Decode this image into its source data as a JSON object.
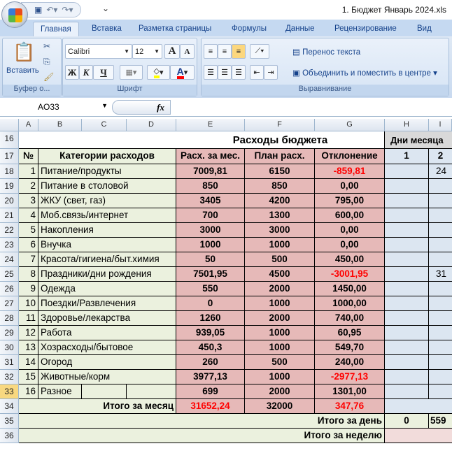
{
  "window": {
    "title": "1.  Бюджет Январь 2024.xls"
  },
  "tabs": [
    "Главная",
    "Вставка",
    "Разметка страницы",
    "Формулы",
    "Данные",
    "Рецензирование",
    "Вид"
  ],
  "ribbon": {
    "clipboard": {
      "label": "Буфер о...",
      "paste": "Вставить"
    },
    "font": {
      "label": "Шрифт",
      "name": "Calibri",
      "size": "12",
      "bold": "Ж",
      "italic": "К",
      "underline": "Ч",
      "grow": "A",
      "shrink": "A",
      "color_letter": "A",
      "fill_color": "#ffff00",
      "font_color": "#ff0000"
    },
    "alignment": {
      "label": "Выравнивание",
      "wrap": "Перенос текста",
      "merge": "Объединить и поместить в центре"
    }
  },
  "formula_bar": {
    "name_box": "AO33",
    "fx": "fx",
    "formula": ""
  },
  "columns": [
    "A",
    "B",
    "C",
    "D",
    "E",
    "F",
    "G",
    "H",
    "I"
  ],
  "sheet": {
    "title": "Расходы бюджета",
    "days_title": "Дни месяца",
    "headers": {
      "num": "№",
      "category": "Категории расходов",
      "spent": "Расх. за мес.",
      "plan": "План расх.",
      "diff": "Отклонение",
      "day1": "1",
      "day2": "2"
    },
    "rows": [
      {
        "row": "18",
        "n": "1",
        "cat": "Питание/продукты",
        "spent": "7009,81",
        "plan": "6150",
        "diff": "-859,81",
        "neg": true,
        "d2": "24"
      },
      {
        "row": "19",
        "n": "2",
        "cat": "Питание в столовой",
        "spent": "850",
        "plan": "850",
        "diff": "0,00"
      },
      {
        "row": "20",
        "n": "3",
        "cat": "ЖКУ (свет, газ)",
        "spent": "3405",
        "plan": "4200",
        "diff": "795,00"
      },
      {
        "row": "21",
        "n": "4",
        "cat": "Моб.связь/интернет",
        "spent": "700",
        "plan": "1300",
        "diff": "600,00"
      },
      {
        "row": "22",
        "n": "5",
        "cat": "Накопления",
        "spent": "3000",
        "plan": "3000",
        "diff": "0,00"
      },
      {
        "row": "23",
        "n": "6",
        "cat": "Внучка",
        "spent": "1000",
        "plan": "1000",
        "diff": "0,00"
      },
      {
        "row": "24",
        "n": "7",
        "cat": "Красота/гигиена/быт.химия",
        "spent": "50",
        "plan": "500",
        "diff": "450,00"
      },
      {
        "row": "25",
        "n": "8",
        "cat": "Праздники/дни рождения",
        "spent": "7501,95",
        "plan": "4500",
        "diff": "-3001,95",
        "neg": true,
        "d2": "31"
      },
      {
        "row": "26",
        "n": "9",
        "cat": "Одежда",
        "spent": "550",
        "plan": "2000",
        "diff": "1450,00"
      },
      {
        "row": "27",
        "n": "10",
        "cat": "Поездки/Развлечения",
        "spent": "0",
        "plan": "1000",
        "diff": "1000,00"
      },
      {
        "row": "28",
        "n": "11",
        "cat": "Здоровье/лекарства",
        "spent": "1260",
        "plan": "2000",
        "diff": "740,00"
      },
      {
        "row": "29",
        "n": "12",
        "cat": "Работа",
        "spent": "939,05",
        "plan": "1000",
        "diff": "60,95"
      },
      {
        "row": "30",
        "n": "13",
        "cat": "Хозрасходы/бытовое",
        "spent": "450,3",
        "plan": "1000",
        "diff": "549,70"
      },
      {
        "row": "31",
        "n": "14",
        "cat": "Огород",
        "spent": "260",
        "plan": "500",
        "diff": "240,00"
      },
      {
        "row": "32",
        "n": "15",
        "cat": "Животные/корм",
        "spent": "3977,13",
        "plan": "1000",
        "diff": "-2977,13",
        "neg": true
      },
      {
        "row": "33",
        "n": "16",
        "cat": "Разное",
        "spent": "699",
        "plan": "2000",
        "diff": "1301,00"
      }
    ],
    "total": {
      "label": "Итого за месяц",
      "spent": "31652,24",
      "plan": "32000",
      "diff": "347,76"
    },
    "per_day": {
      "label": "Итого за день",
      "d1": "0",
      "d2": "559"
    },
    "per_week": {
      "label": "Итого за неделю"
    },
    "row_numbers": [
      "16",
      "17",
      "34",
      "35",
      "36"
    ]
  }
}
